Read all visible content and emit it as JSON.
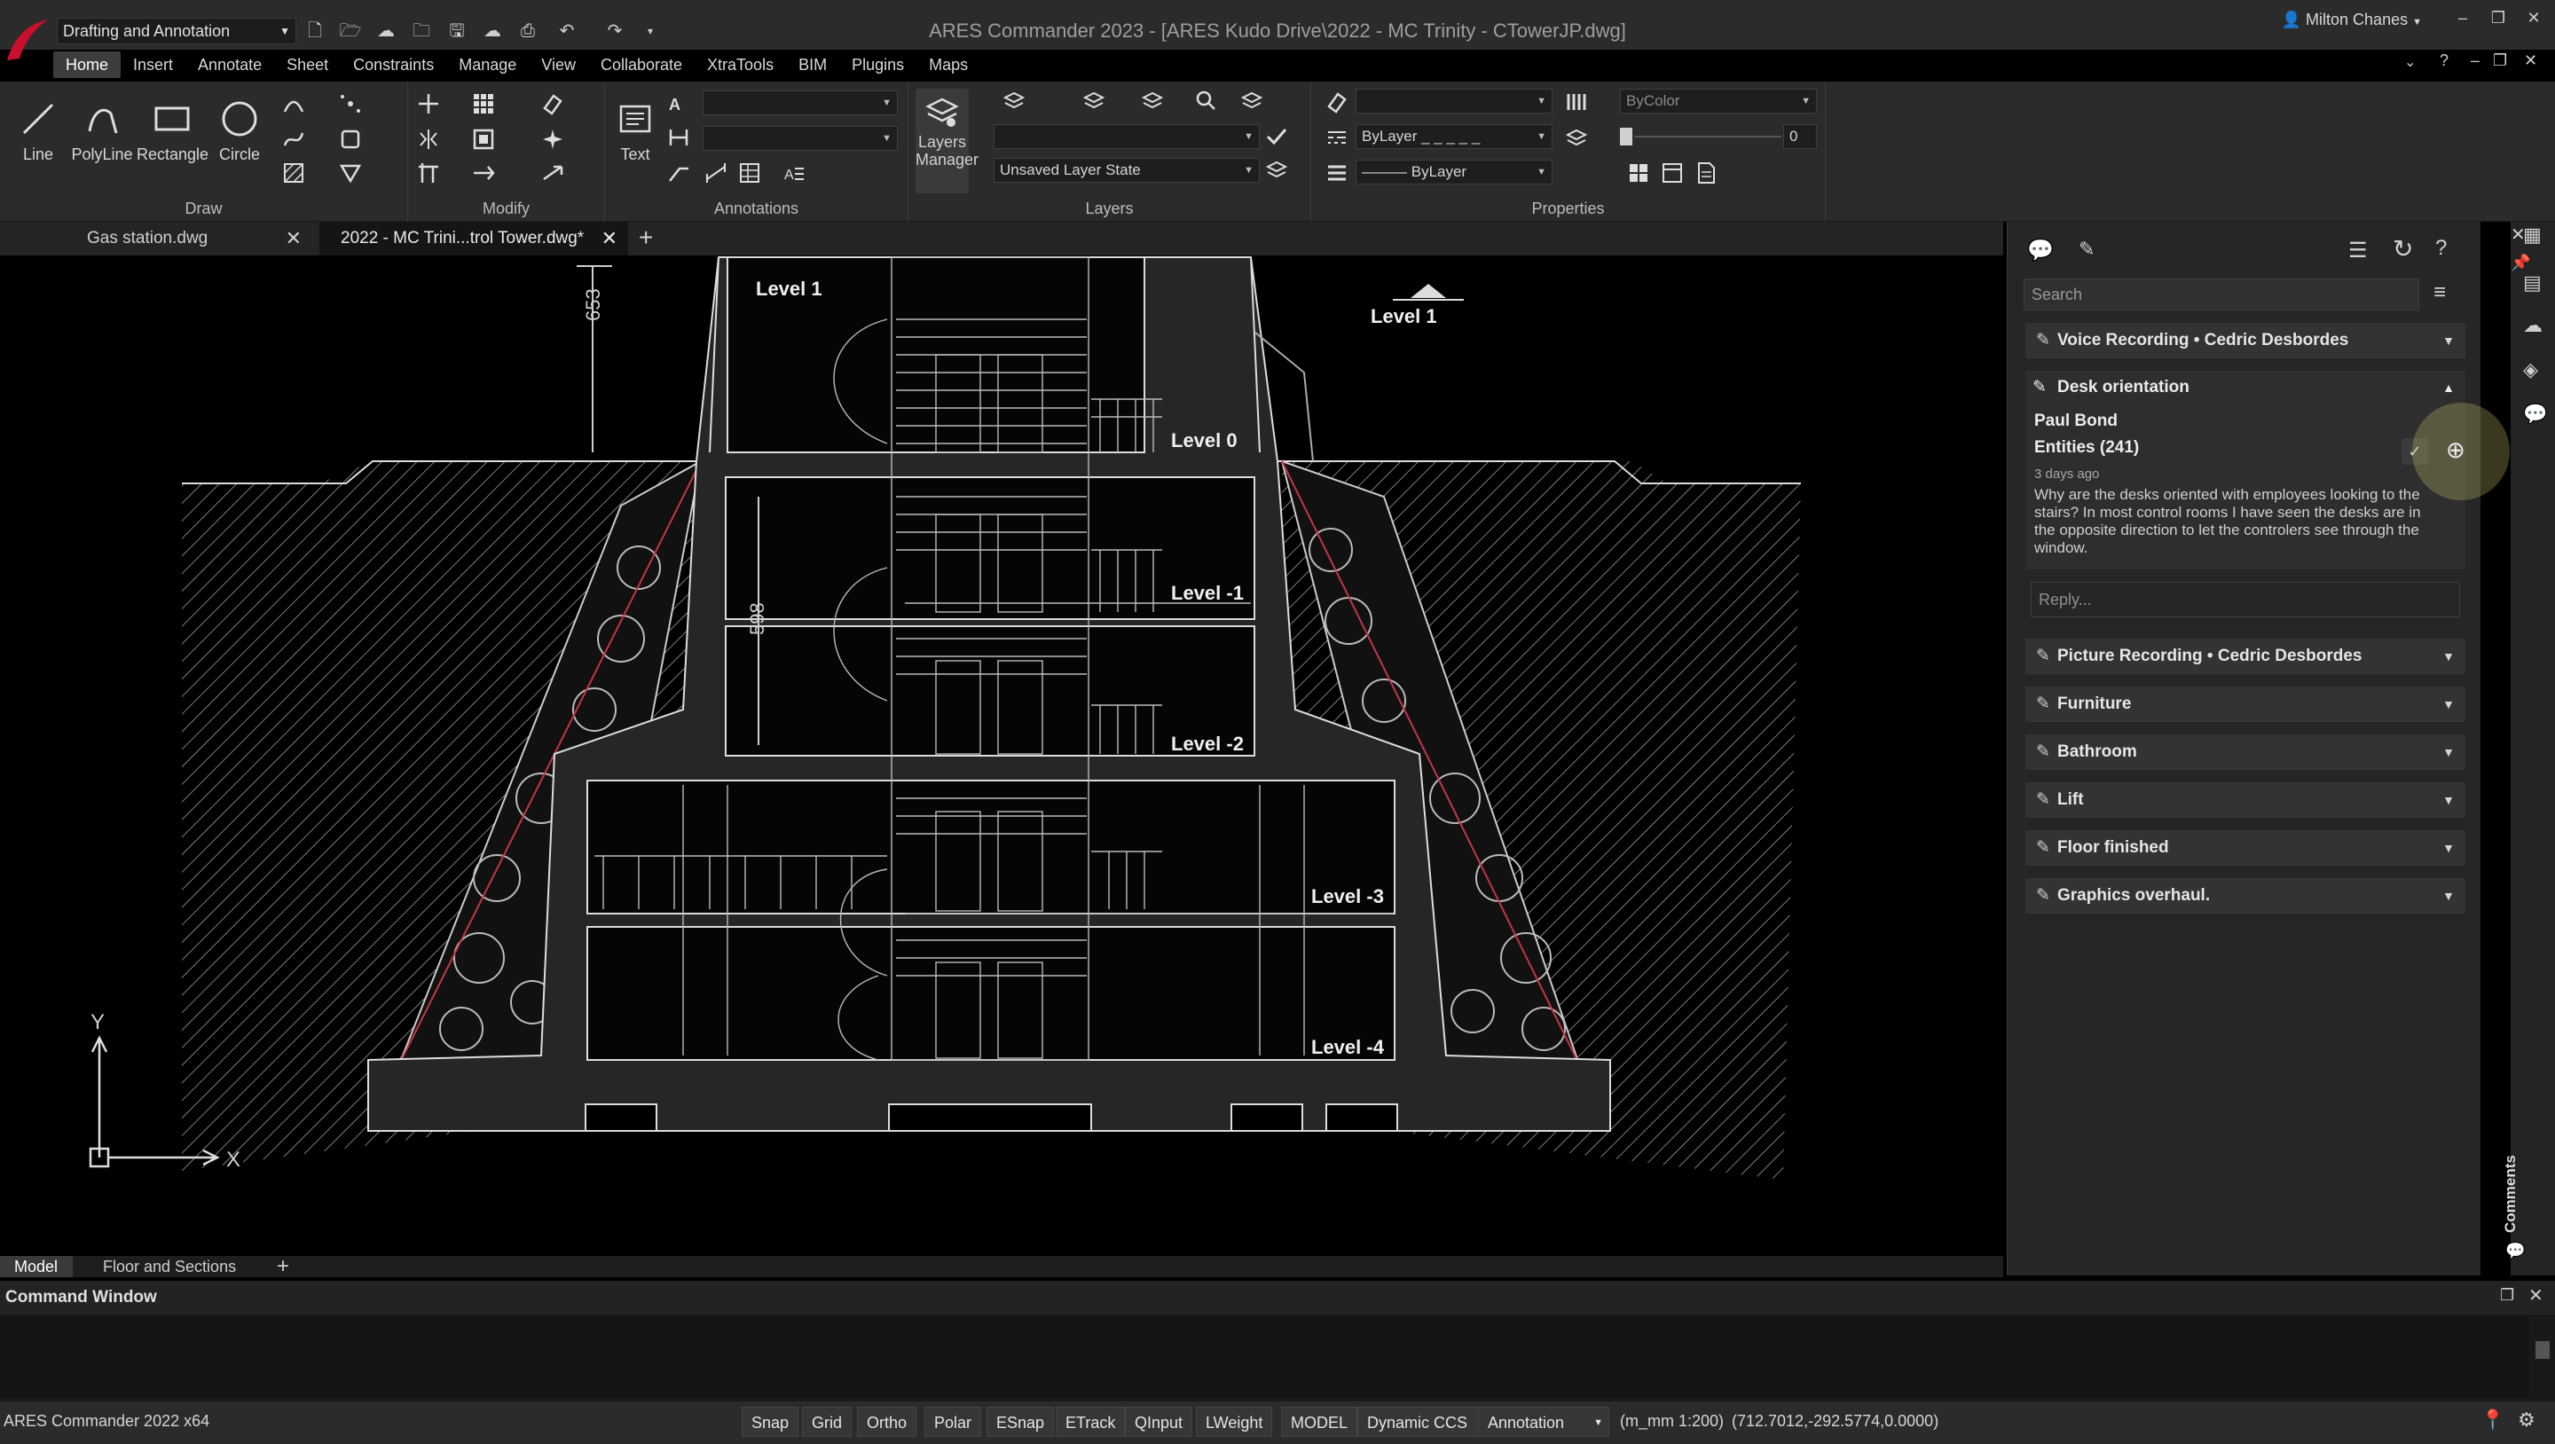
{
  "titlebar": {
    "workspace": "Drafting and Annotation",
    "app_title": "ARES Commander 2023 - [ARES Kudo Drive\\2022 - MC Trinity - CTowerJP.dwg]",
    "user": "Milton Chanes"
  },
  "menu": [
    "Home",
    "Insert",
    "Annotate",
    "Sheet",
    "Constraints",
    "Manage",
    "View",
    "Collaborate",
    "XtraTools",
    "BIM",
    "Plugins",
    "Maps"
  ],
  "ribbon": {
    "draw": {
      "title": "Draw",
      "tools": [
        "Line",
        "PolyLine",
        "Rectangle",
        "Circle"
      ]
    },
    "modify": {
      "title": "Modify"
    },
    "annotations": {
      "title": "Annotations",
      "text_label": "Text"
    },
    "layers": {
      "title": "Layers",
      "manager_label": "Layers Manager",
      "layer_state": "Unsaved Layer State"
    },
    "properties": {
      "title": "Properties",
      "color": "ByColor",
      "linetype": "ByLayer",
      "lineweight": "ByLayer",
      "value": "0"
    }
  },
  "doc_tabs": [
    "Gas station.dwg",
    "2022 - MC Trini...trol Tower.dwg*"
  ],
  "drawing": {
    "levels": [
      "Level 1",
      "Level 1",
      "Level 0",
      "Level -1",
      "Level -2",
      "Level -3",
      "Level -4"
    ],
    "dims": [
      "653",
      "598"
    ],
    "axes": {
      "x": "X",
      "y": "Y"
    }
  },
  "layout_tabs": [
    "Model",
    "Floor and Sections"
  ],
  "comments_panel": {
    "search_placeholder": "Search",
    "side_label": "Comments",
    "expanded": {
      "title": "Desk orientation",
      "author": "Paul Bond",
      "entities": "Entities (241)",
      "time": "3 days ago",
      "body": "Why are the desks oriented with employees looking to the stairs? In most control rooms I have seen the desks are in the opposite direction to let the controlers see through the window.",
      "reply_placeholder": "Reply..."
    },
    "sections": [
      {
        "title": "Voice Recording • Cedric Desbordes",
        "icon": "edit-note-icon"
      },
      {
        "title": "Picture Recording • Cedric Desbordes",
        "icon": "edit-note-icon"
      },
      {
        "title": "Furniture",
        "icon": "pencil-icon"
      },
      {
        "title": "Bathroom",
        "icon": "pencil-icon"
      },
      {
        "title": "Lift",
        "icon": "pencil-icon"
      },
      {
        "title": "Floor finished",
        "icon": "pencil-icon"
      },
      {
        "title": "Graphics overhaul.",
        "icon": "pencil-icon"
      }
    ]
  },
  "command_window": {
    "title": "Command Window"
  },
  "status": {
    "app": "ARES Commander 2022 x64",
    "toggles": [
      "Snap",
      "Grid",
      "Ortho",
      "Polar",
      "ESnap",
      "ETrack",
      "QInput",
      "LWeight",
      "MODEL",
      "Dynamic CCS"
    ],
    "annotation": "Annotation",
    "scale": "(m_mm 1:200)",
    "coords": "(712.7012,-292.5774,0.0000)"
  }
}
